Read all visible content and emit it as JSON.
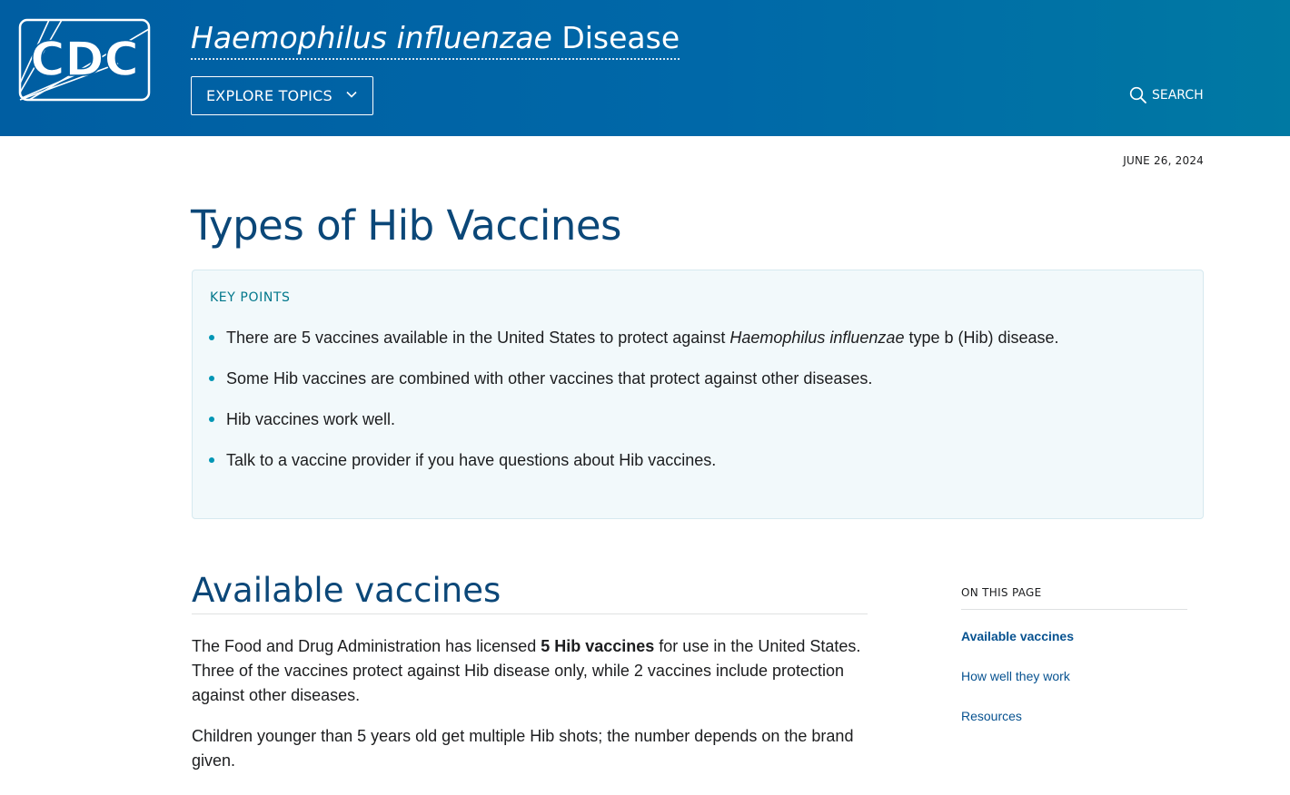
{
  "header": {
    "logo_text": "CDC",
    "title_italic": "Haemophilus influenzae",
    "title_rest": " Disease",
    "explore_label": "EXPLORE TOPICS",
    "search_label": "SEARCH",
    "colors": {
      "gradient_start": "#005ea2",
      "gradient_end": "#0079a3"
    }
  },
  "page": {
    "date": "JUNE 26, 2024",
    "title": "Types of Hib Vaccines"
  },
  "key_points": {
    "heading": "KEY POINTS",
    "items": [
      {
        "before": "There are 5 vaccines available in the United States to protect against ",
        "italic": "Haemophilus influenzae",
        "after": " type b (Hib) disease."
      },
      {
        "text": "Some Hib vaccines are combined with other vaccines that protect against other diseases."
      },
      {
        "text": "Hib vaccines work well."
      },
      {
        "text": "Talk to a vaccine provider if you have questions about Hib vaccines."
      }
    ]
  },
  "section": {
    "heading": "Available vaccines",
    "p1_before": "The Food and Drug Administration has licensed ",
    "p1_bold": "5 Hib vaccines",
    "p1_after": " for use in the United States. Three of the vaccines protect against Hib disease only, while 2 vaccines include protection against other diseases.",
    "p2": "Children younger than 5 years old get multiple Hib shots; the number depends on the brand given."
  },
  "on_this_page": {
    "heading": "ON THIS PAGE",
    "items": [
      {
        "label": "Available vaccines",
        "active": true
      },
      {
        "label": "How well they work",
        "active": false
      },
      {
        "label": "Resources",
        "active": false
      }
    ]
  }
}
